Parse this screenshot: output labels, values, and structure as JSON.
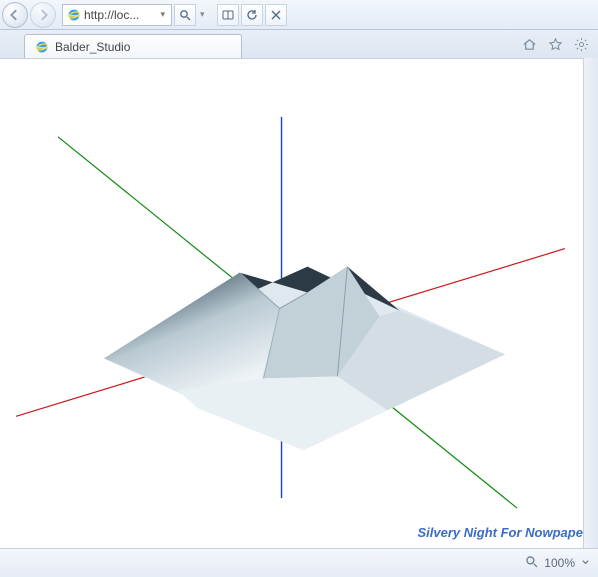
{
  "toolbar": {
    "back_label": "Back",
    "forward_label": "Forward",
    "address_text": "http://loc...",
    "search_icon_name": "search",
    "compat_icon_name": "compat-view",
    "refresh_icon_name": "refresh",
    "stop_icon_name": "stop"
  },
  "tabs": [
    {
      "title": "Balder_Studio",
      "active": true
    }
  ],
  "titlebar_buttons": {
    "home": "Home",
    "favorites": "Favorites",
    "tools": "Tools"
  },
  "content": {
    "credit_text": "Silvery Night For Nowpaper",
    "axes": {
      "x_color": "#cc2020",
      "y_color": "#1060c0",
      "z_color": "#1a8a1a"
    }
  },
  "statusbar": {
    "zoom_text": "100%"
  }
}
